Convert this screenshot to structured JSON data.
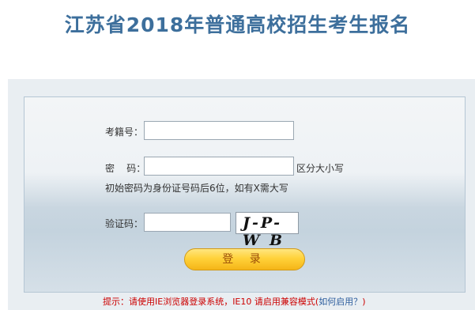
{
  "header": {
    "title": "江苏省2018年普通高校招生考生报名"
  },
  "form": {
    "exam_id_label": "考籍号：",
    "exam_id_value": "",
    "password_label": "密    码：",
    "password_value": "",
    "case_note": "区分大小写",
    "password_hint": "初始密码为身份证号码后6位，如有X需大写",
    "captcha_label": "验证码：",
    "captcha_value": "",
    "captcha_text": "J-P-W B",
    "login_label": "登 录"
  },
  "footer": {
    "tip_prefix": "提示：请使用IE浏览器登录系统，IE10 请启用兼容模式(",
    "tip_link": "如何启用？",
    "tip_suffix": ")"
  },
  "colors": {
    "title": "#3d6f9c",
    "button": "#ffd23a",
    "tip": "#cc0000",
    "link": "#2f5f9e"
  }
}
